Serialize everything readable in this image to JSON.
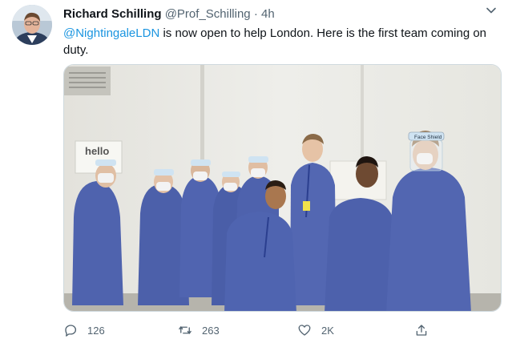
{
  "tweet": {
    "author_name": "Richard Schilling",
    "author_handle": "@Prof_Schilling",
    "separator": "·",
    "time": "4h",
    "text_mention": "@NightingaleLDN",
    "text_body": " is now open to help London. Here is the first team coming on duty.",
    "media_sign_text": "hello",
    "face_shield_label": "Face Shield"
  },
  "actions": {
    "reply_count": "126",
    "retweet_count": "263",
    "like_count": "2K"
  },
  "colors": {
    "link": "#1b95e0",
    "muted": "#536471",
    "scrubs": "#4a5fae"
  },
  "icons": [
    "avatar",
    "caret-down-icon",
    "reply-icon",
    "retweet-icon",
    "like-icon",
    "share-icon"
  ]
}
